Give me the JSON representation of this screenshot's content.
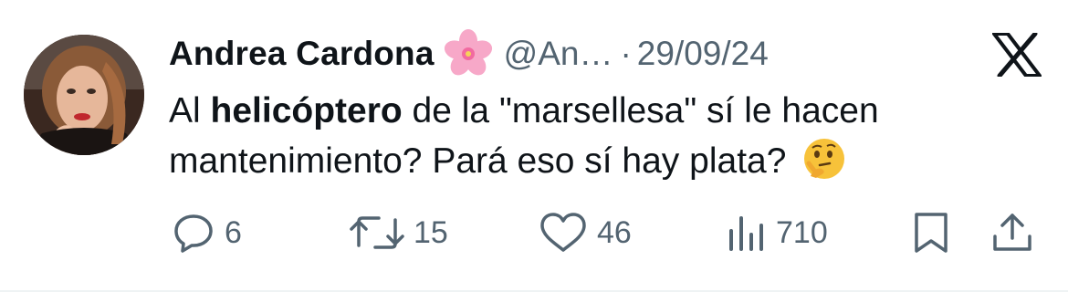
{
  "tweet": {
    "author": {
      "display_name": "Andrea Cardona",
      "name_emoji": "cherry-blossom-icon",
      "handle": "@An…",
      "separator": "·",
      "date": "29/09/24"
    },
    "text": {
      "part1": "Al ",
      "bold": "helicóptero",
      "part2": " de la \"marsellesa\" sí le hacen mantenimiento? Pará eso sí hay plata? ",
      "trailing_emoji": "thinking-face-icon"
    },
    "actions": {
      "replies": "6",
      "retweets": "15",
      "likes": "46",
      "views": "710"
    }
  },
  "colors": {
    "text_primary": "#0f1419",
    "text_secondary": "#536471",
    "divider": "#eff3f4"
  }
}
